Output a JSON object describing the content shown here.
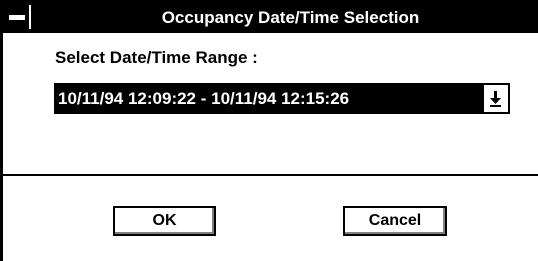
{
  "window": {
    "title": "Occupancy Date/Time Selection"
  },
  "form": {
    "range_label": "Select Date/Time Range :",
    "range_value": "10/11/94 12:09:22 - 10/11/94 12:15:26"
  },
  "buttons": {
    "ok_label": "OK",
    "cancel_label": "Cancel"
  },
  "icons": {
    "system_menu": "system-menu-icon",
    "dropdown": "dropdown-arrow-icon"
  }
}
